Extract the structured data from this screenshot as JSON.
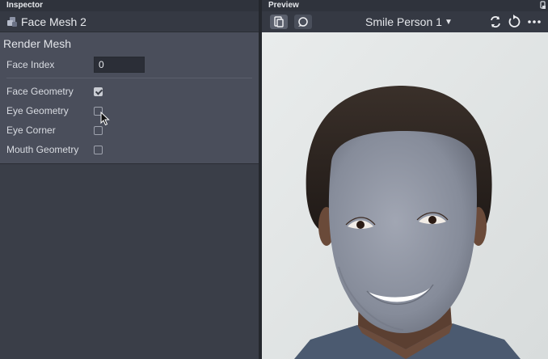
{
  "inspector": {
    "panel_label": "Inspector",
    "object_title": "Face Mesh 2",
    "object_icon": "face-mesh-icon",
    "section_title": "Render Mesh",
    "face_index": {
      "label": "Face Index",
      "value": "0"
    },
    "options": [
      {
        "label": "Face Geometry",
        "checked": true
      },
      {
        "label": "Eye Geometry",
        "checked": false
      },
      {
        "label": "Eye Corner",
        "checked": false
      },
      {
        "label": "Mouth Geometry",
        "checked": false
      }
    ]
  },
  "preview": {
    "panel_label": "Preview",
    "person_select": "Smile Person 1",
    "toolbar_icons": [
      "device-view-icon",
      "speech-bubble-icon",
      "swap-camera-icon",
      "reset-icon",
      "more-icon"
    ]
  },
  "colors": {
    "panel_bg": "#3a3e48",
    "section_bg": "#4a4e5b",
    "mesh": "#8a909e"
  }
}
